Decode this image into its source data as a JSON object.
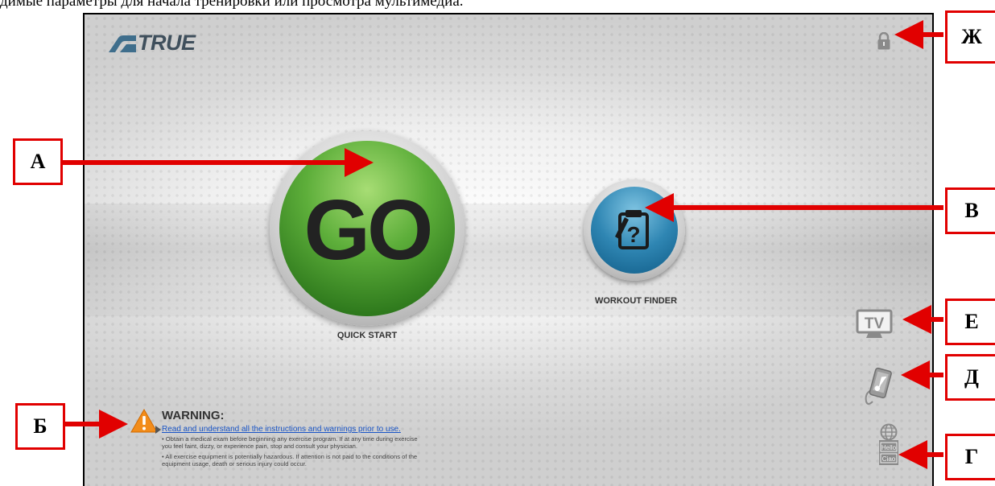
{
  "caption": "димые параметры для начала тренировки или просмотра мультимедиа.",
  "brand": {
    "name": "TRUE"
  },
  "main": {
    "go_text": "GO",
    "quick_start_label": "QUICK START",
    "workout_finder_label": "WORKOUT FINDER"
  },
  "side_icons": {
    "tv_text": "TV",
    "language_line1": "Hello",
    "language_line2": "Ciao"
  },
  "warning": {
    "title": "WARNING:",
    "link_text": "Read and understand all the instructions and warnings prior to use.",
    "bullet1": "• Obtain a medical exam before beginning any exercise program. If at any time during exercise you feel faint, dizzy, or experience pain, stop and consult your physician.",
    "bullet2": "• All exercise equipment is potentially hazardous. If attention is not paid to the conditions of the equipment usage, death or serious injury could occur."
  },
  "callouts": {
    "a": "А",
    "b": "Б",
    "v": "В",
    "g": "Г",
    "d": "Д",
    "e": "Е",
    "zh": "Ж"
  },
  "colors": {
    "callout_red": "#e10000",
    "go_green": "#4a9a2e",
    "finder_blue": "#2f86b3",
    "warning_orange": "#f28c1a",
    "link_blue": "#1a55c6"
  },
  "icons": {
    "lock": "lock-icon",
    "tv": "tv-icon",
    "music": "music-player-icon",
    "language": "language-globe-icon",
    "warning": "warning-triangle-icon",
    "workout_finder": "clipboard-question-icon"
  }
}
